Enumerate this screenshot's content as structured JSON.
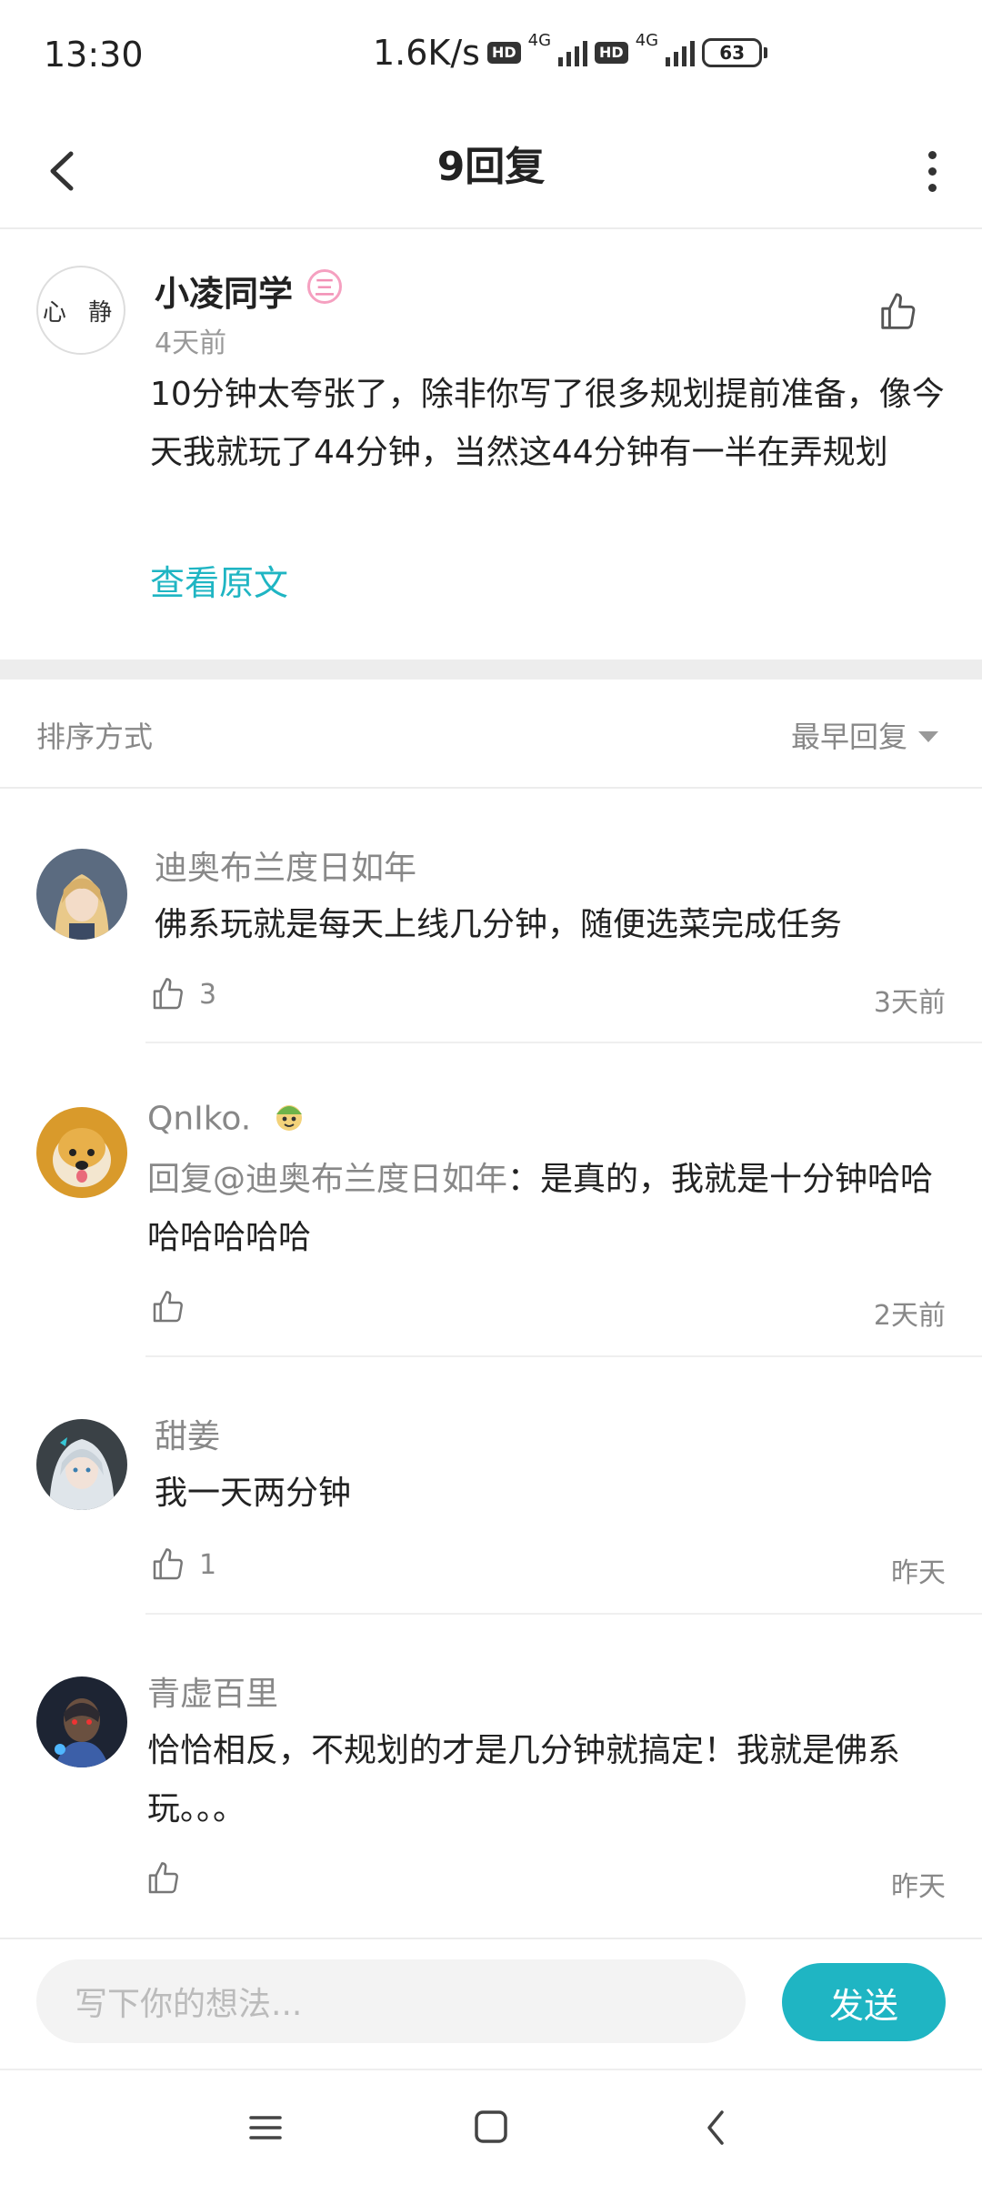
{
  "status_bar": {
    "time": "13:30",
    "speed": "1.6K/s",
    "net1": "4G",
    "net2": "4G",
    "hd": "HD",
    "battery": "63"
  },
  "header": {
    "title": "9回复"
  },
  "original_post": {
    "avatar_text": "心 静",
    "author": "小凌同学",
    "level_badge": "三",
    "time": "4天前",
    "content": "10分钟太夸张了，除非你写了很多规划提前准备，像今天我就玩了44分钟，当然这44分钟有一半在弄规划",
    "view_original": "查看原文"
  },
  "sort": {
    "label": "排序方式",
    "value": "最早回复"
  },
  "replies": [
    {
      "author": "迪奥布兰度日如年",
      "text": "佛系玩就是每天上线几分钟，随便选菜完成任务",
      "likes": "3",
      "time": "3天前"
    },
    {
      "author": "QnIko.",
      "mention": "回复@迪奥布兰度日如年",
      "text": "：是真的，我就是十分钟哈哈哈哈哈哈哈",
      "likes": "",
      "time": "2天前"
    },
    {
      "author": "甜姜",
      "text": "我一天两分钟",
      "likes": "1",
      "time": "昨天"
    },
    {
      "author": "青虚百里",
      "text": "恰恰相反，不规划的才是几分钟就搞定！我就是佛系玩。。。",
      "likes": "",
      "time": "昨天"
    }
  ],
  "input_bar": {
    "placeholder": "写下你的想法...",
    "send_label": "发送"
  },
  "colors": {
    "accent": "#1fb5c3",
    "badge_pink": "#f28fb5"
  }
}
